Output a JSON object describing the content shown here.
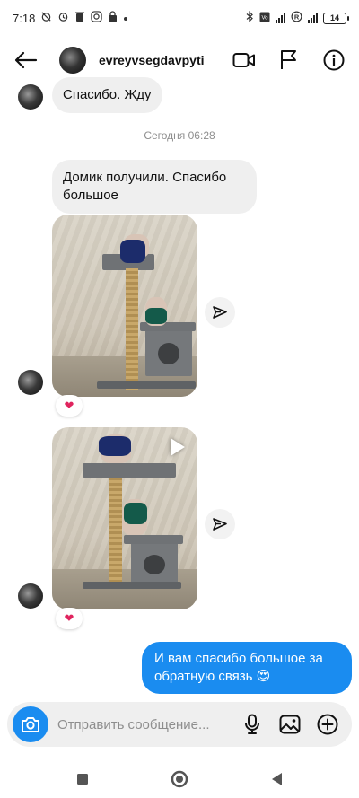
{
  "status_bar": {
    "time": "7:18",
    "battery": "14",
    "left_icons": [
      "alarm-off-icon",
      "alarm-icon",
      "trash-icon",
      "instagram-icon",
      "lock-icon",
      "dot-icon"
    ],
    "right_icons": [
      "bluetooth-icon",
      "volte-icon",
      "signal-icon",
      "roaming-icon",
      "signal-icon"
    ]
  },
  "header": {
    "username": "evreyvsegdavpyti",
    "actions": [
      "video-call-icon",
      "report-flag-icon",
      "info-icon"
    ]
  },
  "messages": {
    "m1": "Спасибо. Жду",
    "timestamp": "Сегодня 06:28",
    "m2": "Домик получили. Спасибо большое",
    "m3_reaction": "❤",
    "m4_reaction": "❤",
    "m5": "И вам спасибо большое за обратную связь 😍"
  },
  "composer": {
    "placeholder": "Отправить сообщение...",
    "value": ""
  },
  "colors": {
    "accent": "#1a8cf0",
    "incoming_bubble": "#efefef",
    "reaction": "#e0245e"
  }
}
